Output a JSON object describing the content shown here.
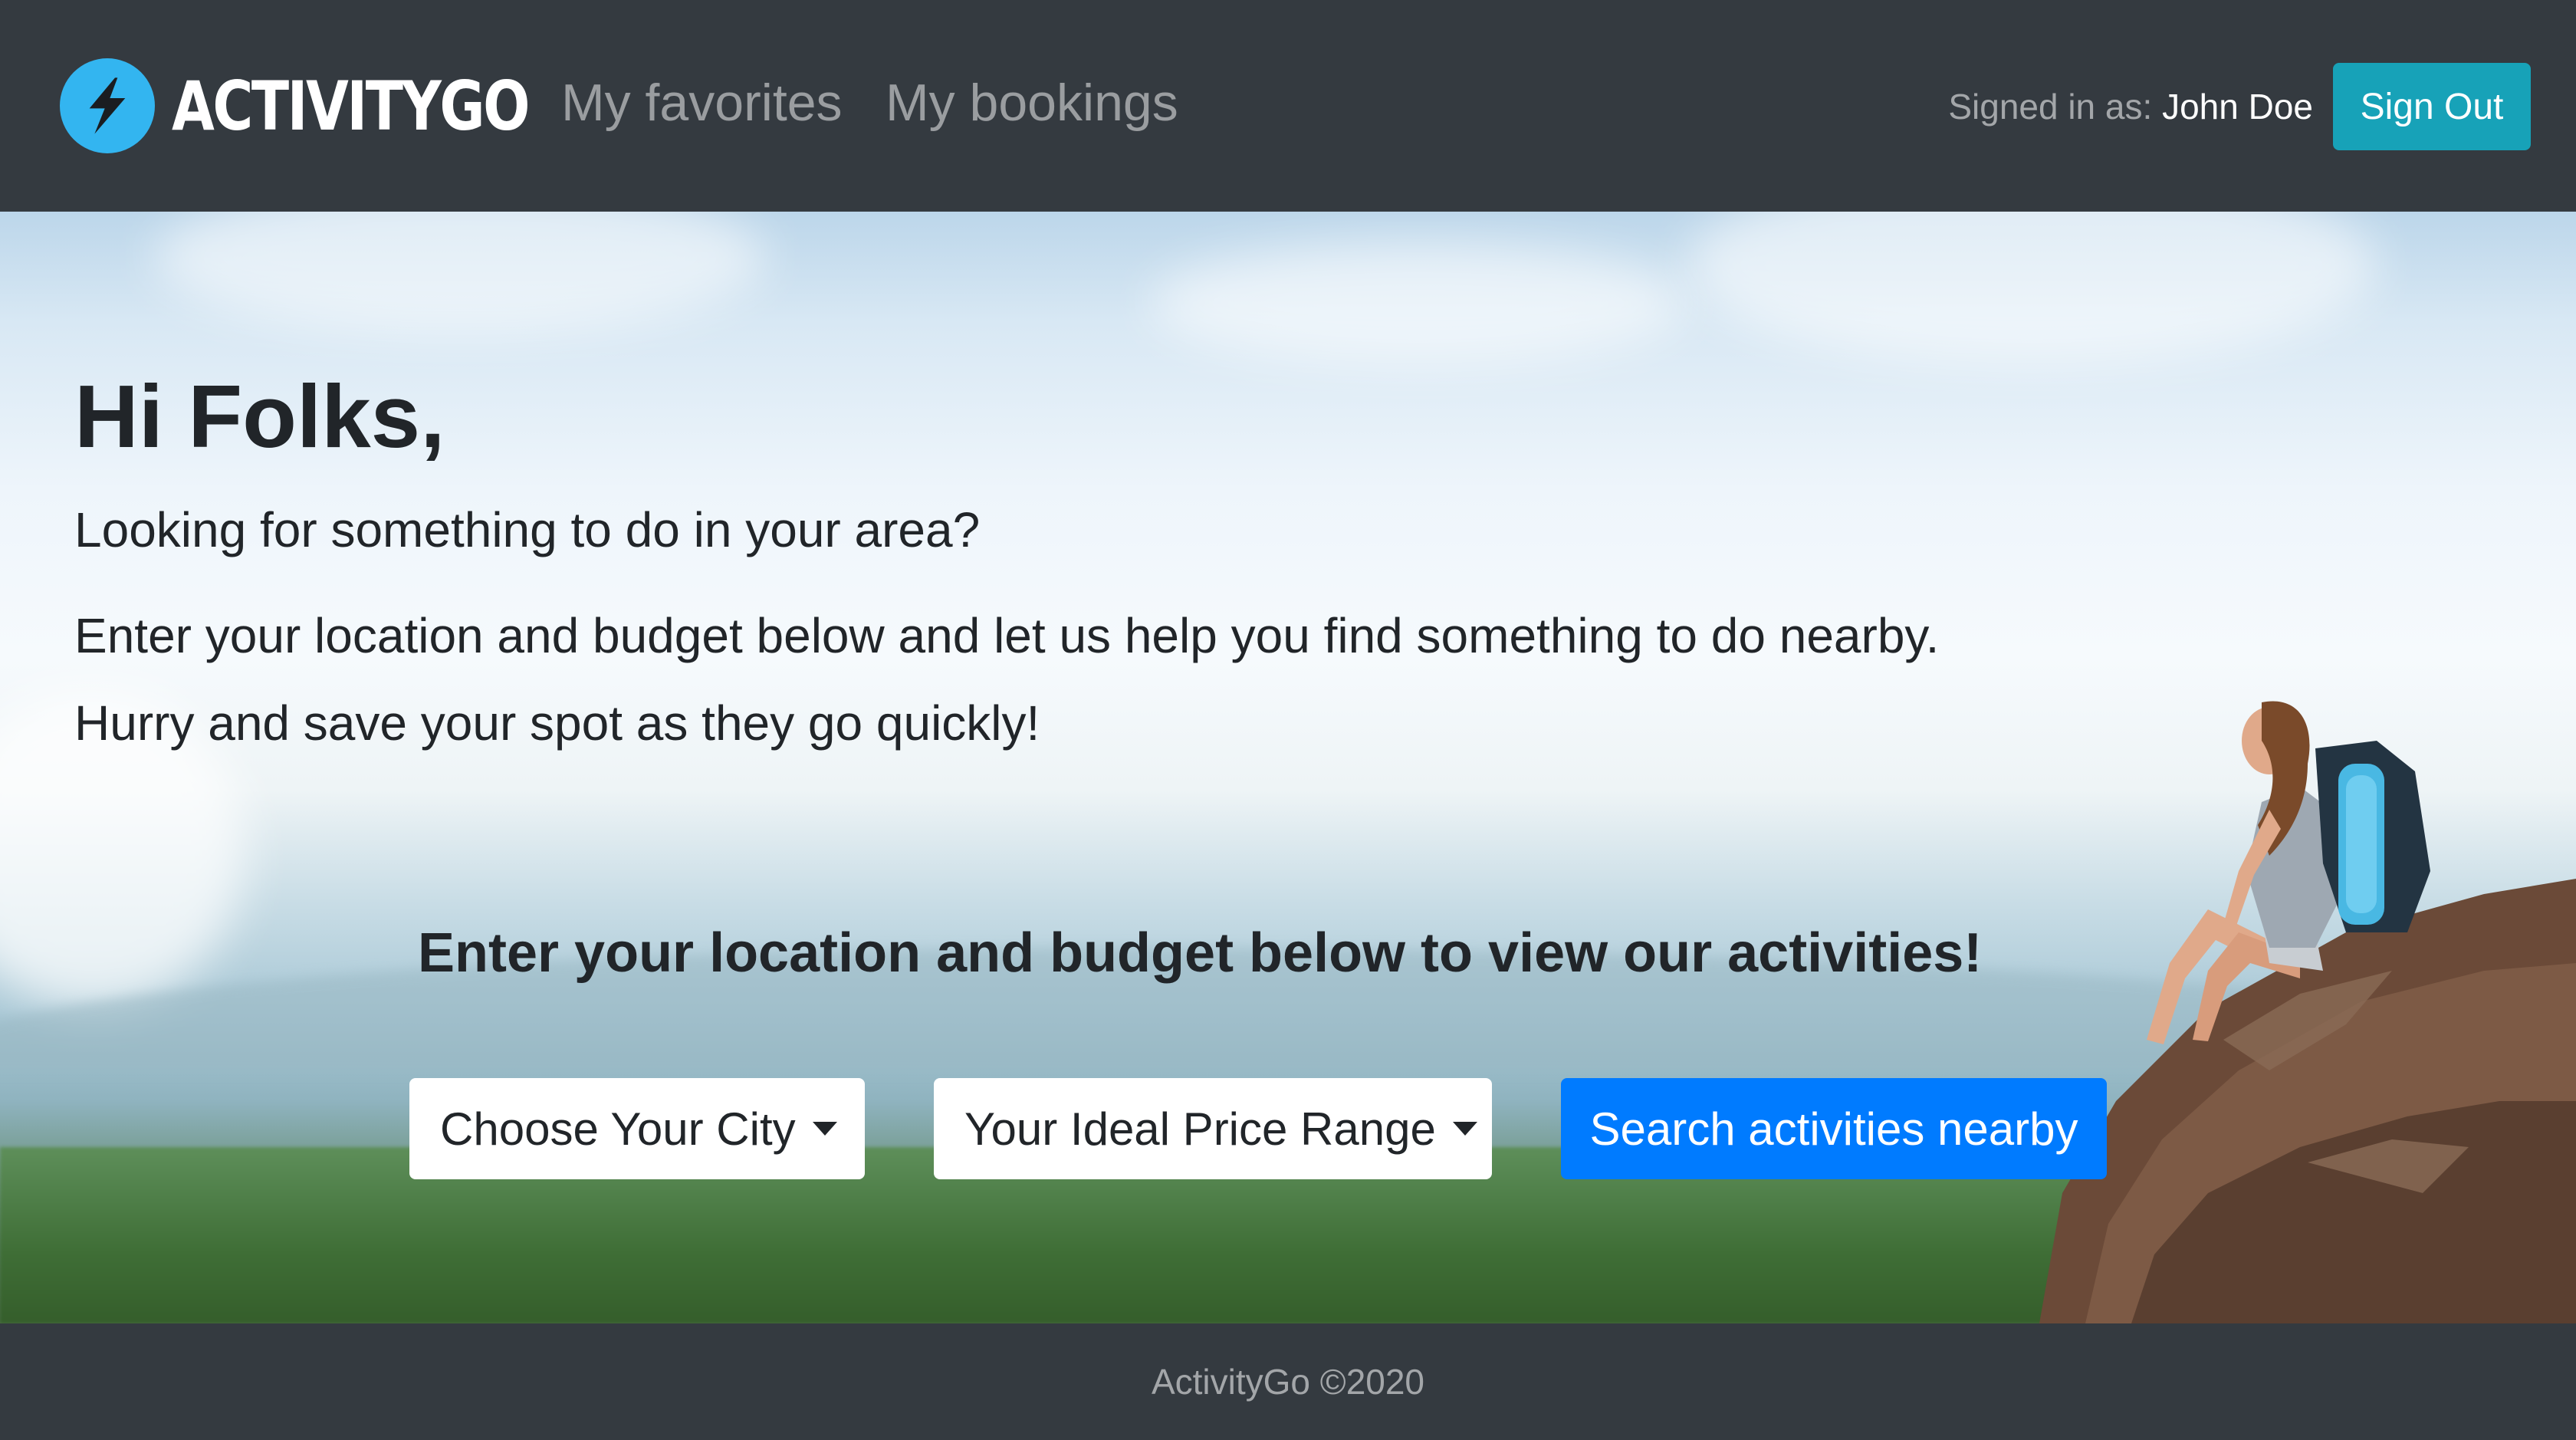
{
  "nav": {
    "brand": "ACTIVITYGO",
    "brand_icon": "lightning-bolt-icon",
    "links": [
      "My favorites",
      "My bookings"
    ],
    "signed_in_label": "Signed in as:",
    "username": "John Doe",
    "signout_label": "Sign Out"
  },
  "hero": {
    "title": "Hi Folks,",
    "lead": "Looking for something to do in your area?",
    "text1": "Enter your location and budget below and let us help you find something to do nearby.",
    "text2": "Hurry and save your spot as they go quickly!",
    "cta": "Enter your location and budget below to view our activities!",
    "city_dropdown": "Choose Your City",
    "price_dropdown": "Your Ideal Price Range",
    "search_button": "Search activities nearby"
  },
  "footer": {
    "text": "ActivityGo ©2020"
  },
  "colors": {
    "navbar_bg": "#343a40",
    "brand_icon_bg": "#33b5f0",
    "signout_bg": "#17a2b8",
    "search_bg": "#007bff"
  }
}
